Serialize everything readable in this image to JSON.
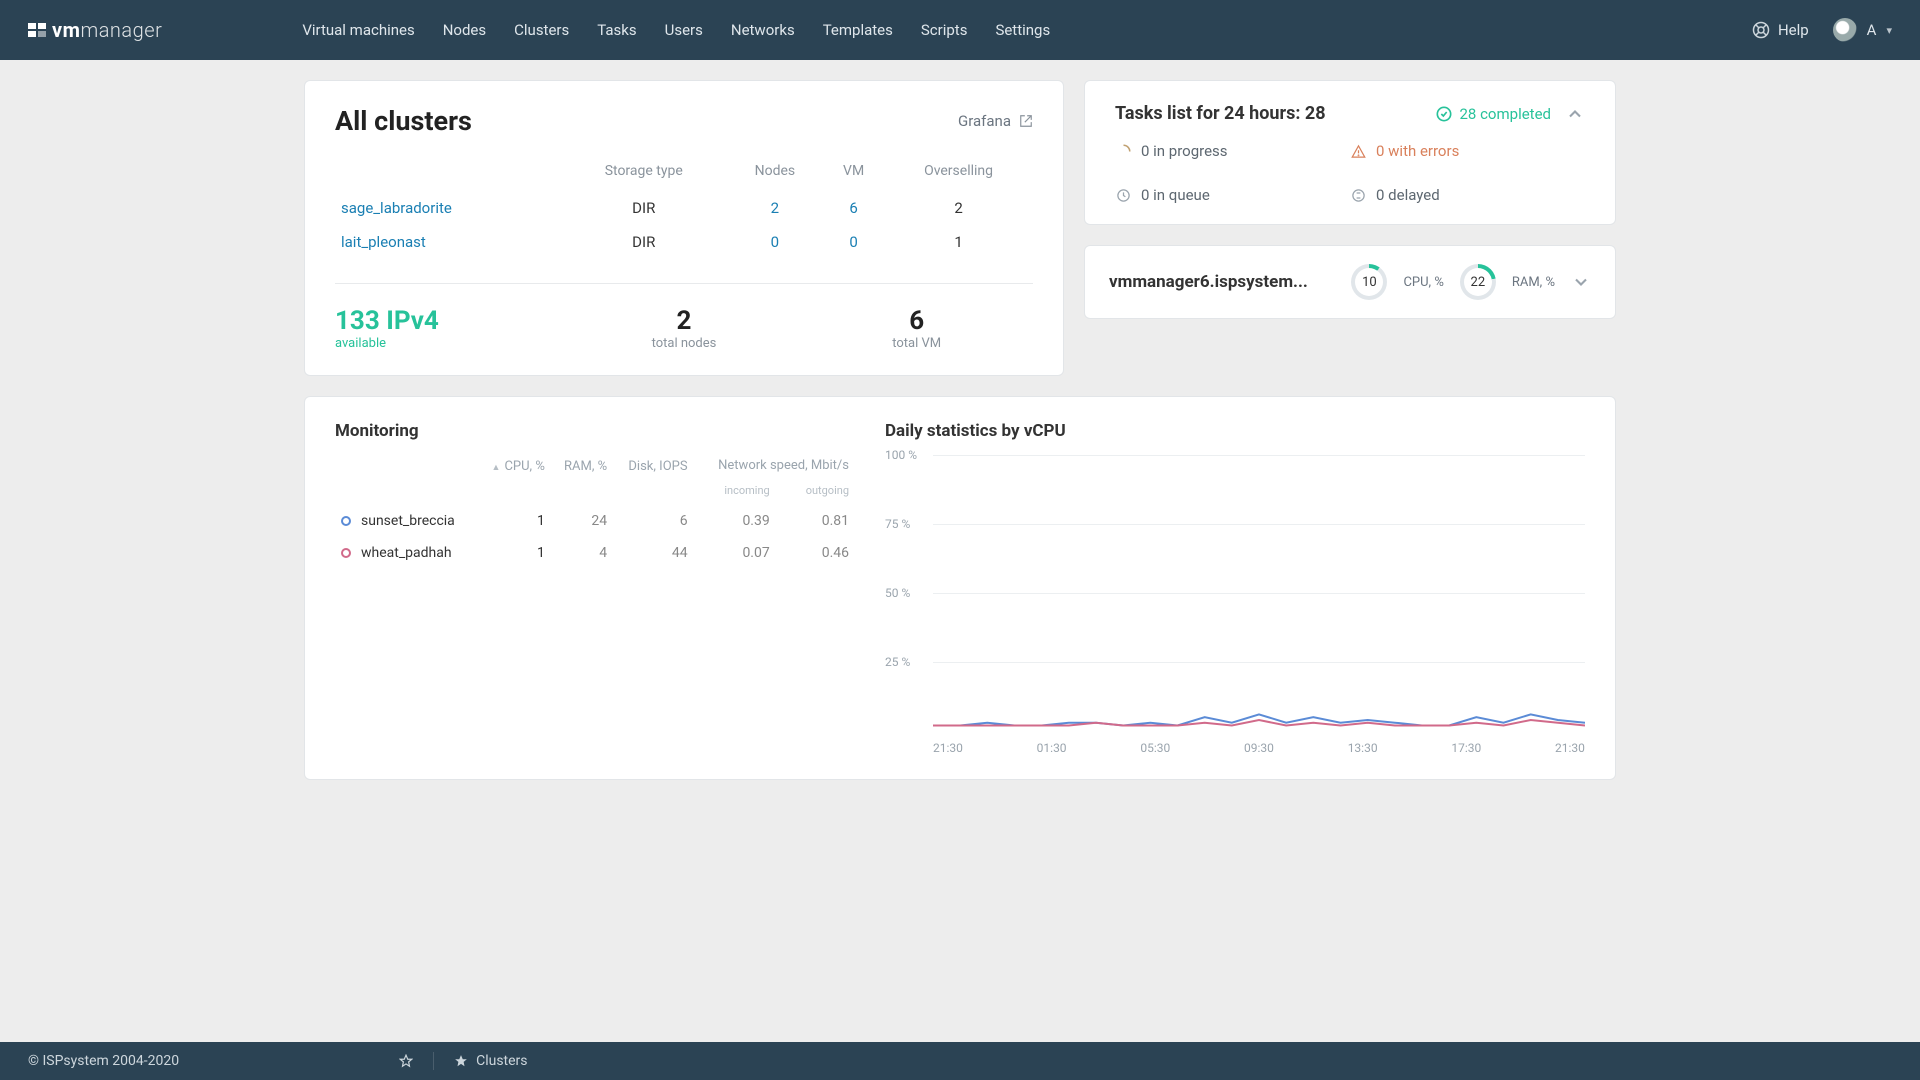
{
  "brand": {
    "bold": "vm",
    "light": "manager"
  },
  "nav": [
    "Virtual machines",
    "Nodes",
    "Clusters",
    "Tasks",
    "Users",
    "Networks",
    "Templates",
    "Scripts",
    "Settings"
  ],
  "help": "Help",
  "user": {
    "name": "A"
  },
  "clusters": {
    "title": "All clusters",
    "grafana": "Grafana",
    "headers": {
      "storage": "Storage type",
      "nodes": "Nodes",
      "vm": "VM",
      "oversell": "Overselling"
    },
    "rows": [
      {
        "name": "sage_labradorite",
        "storage": "DIR",
        "nodes": "2",
        "vm": "6",
        "oversell": "2"
      },
      {
        "name": "lait_pleonast",
        "storage": "DIR",
        "nodes": "0",
        "vm": "0",
        "oversell": "1"
      }
    ],
    "ip": {
      "big": "133 IPv4",
      "sub": "available"
    },
    "totals": {
      "nodes": "2",
      "nodes_sub": "total nodes",
      "vm": "6",
      "vm_sub": "total VM"
    }
  },
  "tasks": {
    "title": "Tasks list for 24 hours: 28",
    "completed": "28 completed",
    "items": {
      "progress": "0 in progress",
      "errors": "0 with errors",
      "queue": "0 in queue",
      "delayed": "0 delayed"
    }
  },
  "node": {
    "name": "vmmanager6.ispsystem...",
    "cpu_val": "10",
    "cpu_lbl": "CPU, %",
    "ram_val": "22",
    "ram_lbl": "RAM, %"
  },
  "monitoring": {
    "title": "Monitoring",
    "headers": {
      "cpu": "CPU, %",
      "ram": "RAM, %",
      "disk": "Disk, IOPS",
      "net": "Network speed, Mbit/s",
      "net_in": "incoming",
      "net_out": "outgoing"
    },
    "rows": [
      {
        "name": "sunset_breccia",
        "color": "blue",
        "cpu": "1",
        "ram": "24",
        "disk": "6",
        "in": "0.39",
        "out": "0.81"
      },
      {
        "name": "wheat_padhah",
        "color": "red",
        "cpu": "1",
        "ram": "4",
        "disk": "44",
        "in": "0.07",
        "out": "0.46"
      }
    ]
  },
  "chart_data": {
    "type": "line",
    "title": "Daily statistics by vCPU",
    "ylabel": "%",
    "ylim": [
      0,
      100
    ],
    "yticks": [
      "100 %",
      "75 %",
      "50 %",
      "25 %"
    ],
    "categories": [
      "21:30",
      "01:30",
      "05:30",
      "09:30",
      "13:30",
      "17:30",
      "21:30"
    ],
    "series": [
      {
        "name": "sunset_breccia",
        "color": "#5b8bd6",
        "values": [
          2,
          2,
          3,
          2,
          2,
          3,
          3,
          2,
          3,
          2,
          5,
          3,
          6,
          3,
          5,
          3,
          4,
          3,
          2,
          2,
          5,
          3,
          6,
          4,
          3
        ]
      },
      {
        "name": "wheat_padhah",
        "color": "#d16a8a",
        "values": [
          2,
          2,
          2,
          2,
          2,
          2,
          3,
          2,
          2,
          2,
          3,
          2,
          4,
          2,
          3,
          2,
          3,
          2,
          2,
          2,
          3,
          2,
          4,
          3,
          2
        ]
      }
    ]
  },
  "footer": {
    "copyright": "© ISPsystem 2004-2020",
    "crumb": "Clusters"
  }
}
